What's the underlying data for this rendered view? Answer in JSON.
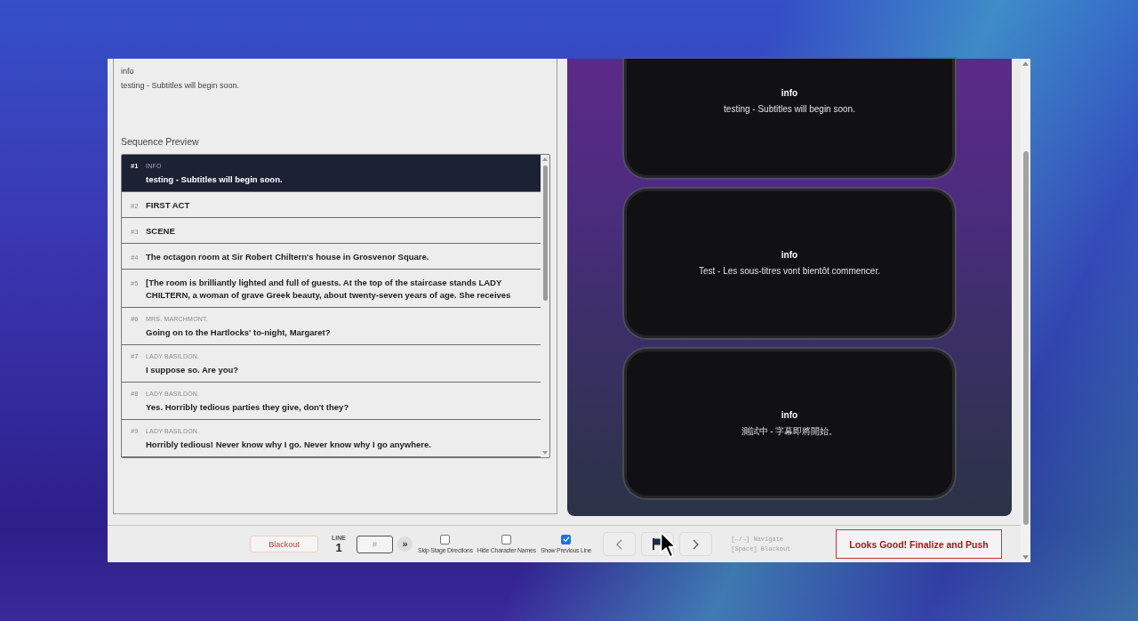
{
  "info_panel": {
    "category": "info",
    "text": "testing - Subtitles will begin soon."
  },
  "sequence_preview": {
    "title": "Sequence Preview",
    "items": [
      {
        "number": "#1",
        "speaker": "INFO",
        "text": "testing - Subtitles will begin soon.",
        "selected": true
      },
      {
        "number": "#2",
        "text": "FIRST ACT",
        "selected": false
      },
      {
        "number": "#3",
        "text": "SCENE",
        "selected": false
      },
      {
        "number": "#4",
        "text": "The octagon room at Sir Robert Chiltern's house in Grosvenor Square.",
        "selected": false
      },
      {
        "number": "#5",
        "text": "[The room is brilliantly lighted and full of guests. At the top of the staircase stands LADY CHILTERN, a woman of grave Greek beauty, about twenty-seven years of age. She receives",
        "selected": false
      },
      {
        "number": "#6",
        "speaker": "MRS. MARCHMONT.",
        "text": "Going on to the Hartlocks' to-night, Margaret?",
        "selected": false
      },
      {
        "number": "#7",
        "speaker": "LADY BASILDON.",
        "text": "I suppose so. Are you?",
        "selected": false
      },
      {
        "number": "#8",
        "speaker": "LADY BASILDON.",
        "text": "Yes. Horribly tedious parties they give, don't they?",
        "selected": false
      },
      {
        "number": "#9",
        "speaker": "LADY BASILDON.",
        "text": "Horribly tedious! Never know why I go. Never know why I go anywhere.",
        "selected": false
      }
    ]
  },
  "preview_cards": [
    {
      "label": "info",
      "text": "testing - Subtitles will begin soon."
    },
    {
      "label": "info",
      "text": "Test - Les sous-titres vont bientôt commencer."
    },
    {
      "label": "info",
      "text": "測試中 - 字幕即將開始。"
    }
  ],
  "toolbar": {
    "blackout_button": "Blackout",
    "line_label": "LINE",
    "line_number": "1",
    "jump_field": {
      "placeholder": "#"
    },
    "jump_button": "»",
    "options": [
      {
        "label": "Skip Stage Directions",
        "checked": false
      },
      {
        "label": "Hide Character Names",
        "checked": false
      },
      {
        "label": "Show Previous Line",
        "checked": true
      }
    ],
    "shortcuts": [
      "[←/→] Navigate",
      "[Space] Blackout"
    ],
    "finalize_button": "Looks Good! Finalize and Push"
  }
}
